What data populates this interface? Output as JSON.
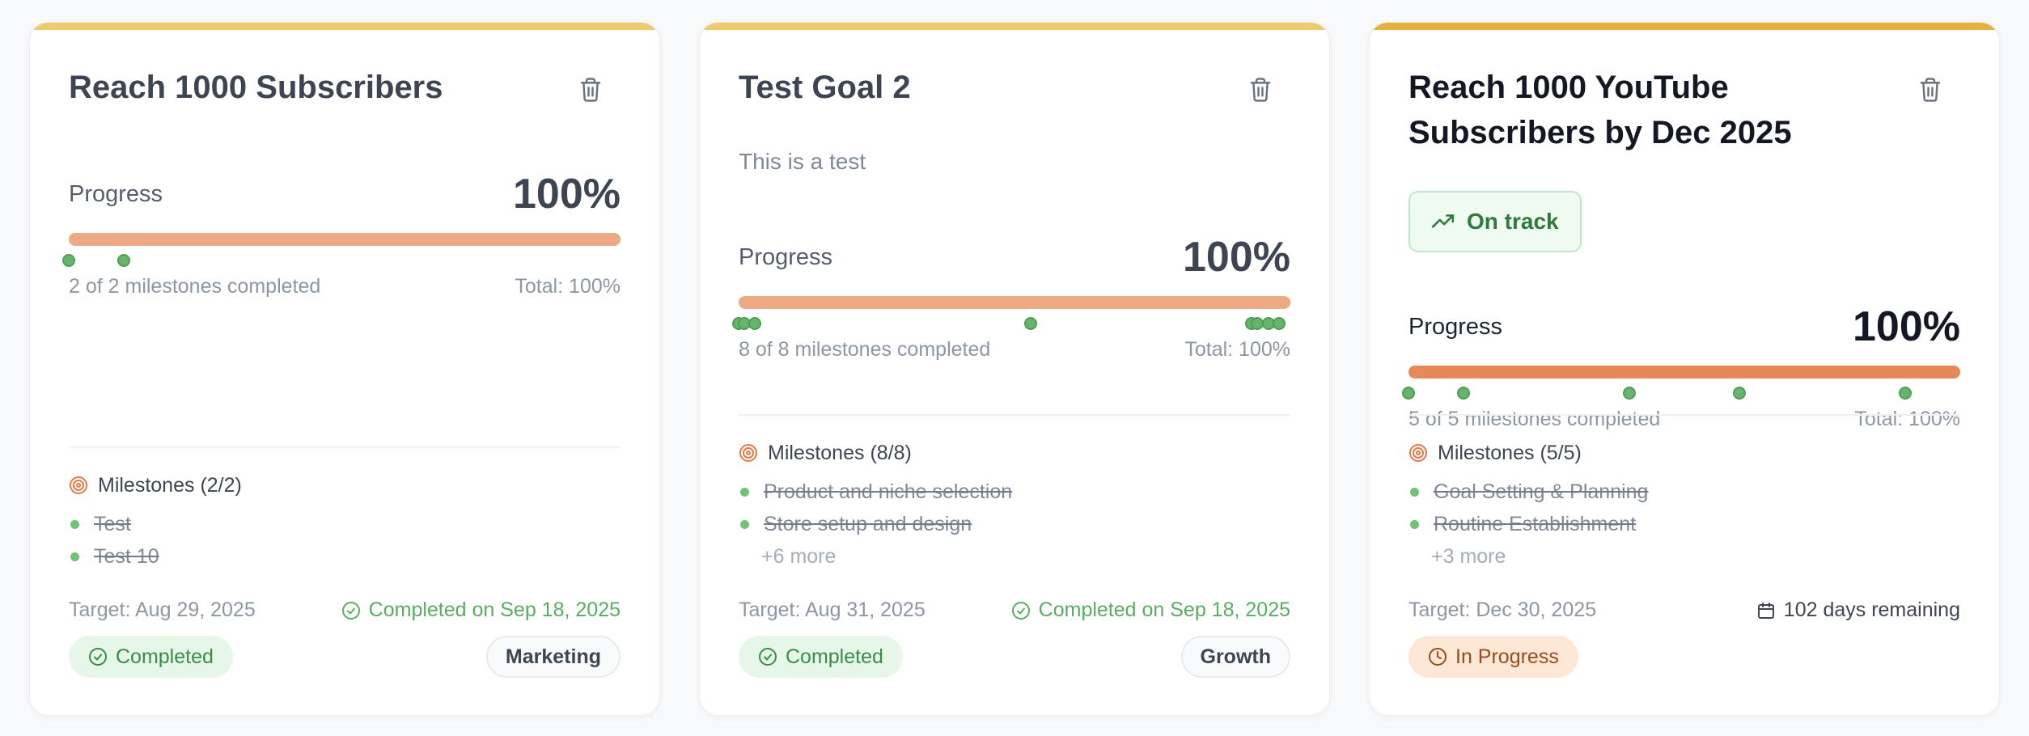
{
  "goals": [
    {
      "title": "Reach 1000 Subscribers",
      "progress_label": "Progress",
      "progress_value": "100%",
      "progress_fraction": 1.0,
      "milestone_markers": [
        0.0,
        0.1
      ],
      "milestones_summary": "2 of 2 milestones completed",
      "total_label": "Total: 100%",
      "milestones_heading": "Milestones (2/2)",
      "milestones": [
        "Test",
        "Test 10"
      ],
      "target": "Target: Aug 29, 2025",
      "completion": "Completed on Sep 18, 2025",
      "status": "Completed",
      "category": "Marketing"
    },
    {
      "title": "Test Goal 2",
      "description": "This is a test",
      "progress_label": "Progress",
      "progress_value": "100%",
      "progress_fraction": 1.0,
      "milestone_markers": [
        0.0,
        0.01,
        0.03,
        0.53,
        0.93,
        0.94,
        0.96,
        0.98
      ],
      "milestones_summary": "8 of 8 milestones completed",
      "total_label": "Total: 100%",
      "milestones_heading": "Milestones (8/8)",
      "milestones": [
        "Product and niche selection",
        "Store setup and design"
      ],
      "more": "+6 more",
      "target": "Target: Aug 31, 2025",
      "completion": "Completed on Sep 18, 2025",
      "status": "Completed",
      "category": "Growth"
    },
    {
      "title": "Reach 1000 YouTube Subscribers by Dec 2025",
      "track_status": "On track",
      "progress_label": "Progress",
      "progress_value": "100%",
      "progress_fraction": 1.0,
      "milestone_markers": [
        0.0,
        0.1,
        0.4,
        0.6,
        0.9
      ],
      "milestones_summary": "5 of 5 milestones completed",
      "total_label": "Total: 100%",
      "milestones_heading": "Milestones (5/5)",
      "milestones": [
        "Goal Setting & Planning",
        "Routine Establishment"
      ],
      "more": "+3 more",
      "target": "Target: Dec 30, 2025",
      "remaining": "102 days remaining",
      "status": "In Progress"
    }
  ],
  "colors": {
    "accent_completed": "#efca6a",
    "accent_active": "#e6b03f",
    "progress_fill": "#eda884",
    "progress_fill_active": "#e6885a",
    "milestone_dot": "#67b56d",
    "completed_text": "#59ad62",
    "in_progress_badge": "#fde8d6"
  },
  "icons": {
    "delete": "trash-icon",
    "milestones": "target-icon",
    "completed": "check-circle-icon",
    "on_track": "trending-up-icon",
    "in_progress": "clock-icon",
    "remaining": "calendar-icon"
  }
}
